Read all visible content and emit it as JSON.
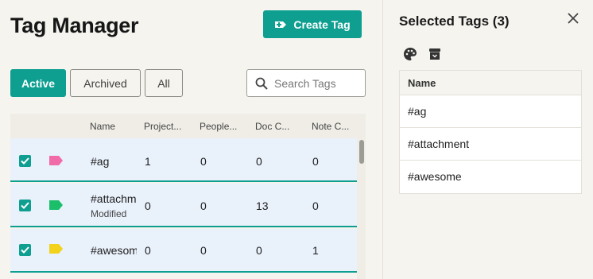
{
  "header": {
    "title": "Tag Manager",
    "create_button": "Create Tag"
  },
  "filters": [
    {
      "label": "Active",
      "selected": true
    },
    {
      "label": "Archived",
      "selected": false
    },
    {
      "label": "All",
      "selected": false
    }
  ],
  "search": {
    "placeholder": "Search Tags",
    "value": ""
  },
  "table": {
    "columns": [
      "Name",
      "Project...",
      "People...",
      "Doc C...",
      "Note C..."
    ],
    "rows": [
      {
        "checked": true,
        "tag_color": "#f06ba8",
        "name": "#ag",
        "subtitle": "",
        "projects": "1",
        "people": "0",
        "docs": "0",
        "notes": "0"
      },
      {
        "checked": true,
        "tag_color": "#1bbf6a",
        "name": "#attachment",
        "subtitle": "Modified",
        "projects": "0",
        "people": "0",
        "docs": "13",
        "notes": "0"
      },
      {
        "checked": true,
        "tag_color": "#f2d21b",
        "name": "#awesome",
        "subtitle": "",
        "projects": "0",
        "people": "0",
        "docs": "0",
        "notes": "1"
      }
    ]
  },
  "panel": {
    "title": "Selected Tags (3)",
    "icons": [
      "palette-icon",
      "archive-icon"
    ],
    "column": "Name",
    "items": [
      "#ag",
      "#attachment",
      "#awesome"
    ]
  },
  "colors": {
    "accent": "#0e9f91",
    "row_selected_bg": "#e9f1fb",
    "background": "#f5f4ef"
  }
}
